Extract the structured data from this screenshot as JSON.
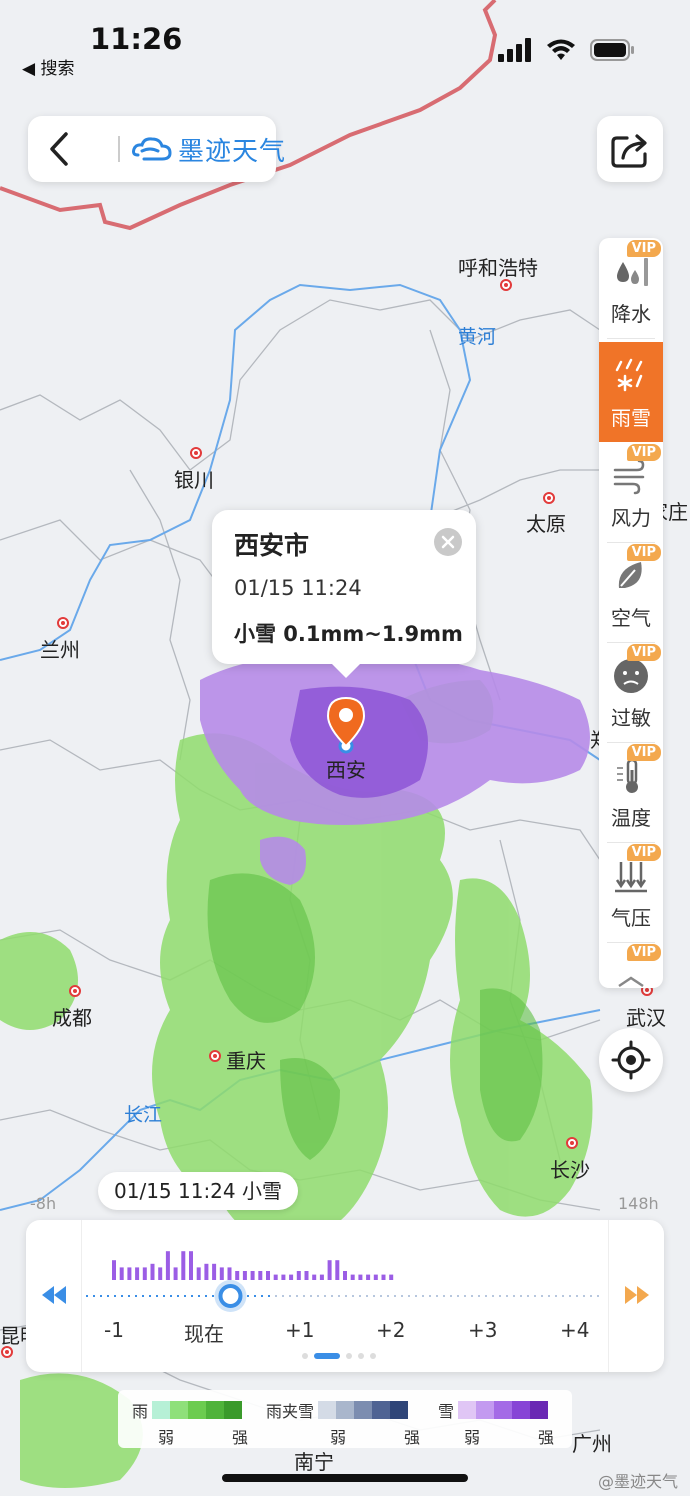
{
  "status": {
    "time": "11:26",
    "back_label": "◀ 搜索"
  },
  "header": {
    "app_name": "墨迹天气"
  },
  "layers": [
    {
      "label": "降水",
      "vip": "VIP",
      "icon": "rain-drops-icon"
    },
    {
      "label": "雨雪",
      "vip": "",
      "icon": "rain-snow-icon"
    },
    {
      "label": "风力",
      "vip": "VIP",
      "icon": "wind-icon"
    },
    {
      "label": "空气",
      "vip": "VIP",
      "icon": "leaf-icon"
    },
    {
      "label": "过敏",
      "vip": "VIP",
      "icon": "allergy-face-icon"
    },
    {
      "label": "温度",
      "vip": "VIP",
      "icon": "thermometer-icon"
    },
    {
      "label": "气压",
      "vip": "VIP",
      "icon": "pressure-icon"
    },
    {
      "label": "",
      "vip": "VIP",
      "icon": "more-layer-icon"
    }
  ],
  "popup": {
    "city": "西安市",
    "time": "01/15 11:24",
    "amount": "小雪 0.1mm~1.9mm"
  },
  "cities": [
    "呼和浩特",
    "银川",
    "太原",
    "兰州",
    "西安",
    "成都",
    "重庆",
    "武汉",
    "长沙",
    "南宁",
    "家庄",
    "郑",
    "昆明",
    "广州"
  ],
  "rivers": [
    "黄河",
    "长江"
  ],
  "timeline": {
    "bubble": "01/15 11:24  小雪",
    "left_label": "-8h",
    "right_label": "148h",
    "hours": [
      "-1",
      "现在",
      "+1",
      "+2",
      "+3",
      "+4"
    ],
    "bars": [
      0.55,
      0.35,
      0.35,
      0.35,
      0.35,
      0.45,
      0.35,
      0.8,
      0.35,
      0.8,
      0.8,
      0.35,
      0.45,
      0.45,
      0.35,
      0.35,
      0.25,
      0.25,
      0.25,
      0.25,
      0.25,
      0.15,
      0.15,
      0.15,
      0.25,
      0.25,
      0.15,
      0.15,
      0.55,
      0.55,
      0.25,
      0.15,
      0.15,
      0.15,
      0.15,
      0.15,
      0.15
    ],
    "current_position": 0.28
  },
  "legend": {
    "rain": "雨",
    "mixed": "雨夹雪",
    "snow": "雪",
    "weak": "弱",
    "strong": "强",
    "rain_colors": [
      "#b6f0d6",
      "#8fe07a",
      "#6ccc4f",
      "#4fb33a",
      "#3a9a2b"
    ],
    "mixed_colors": [
      "#d4dbe6",
      "#a9b6cc",
      "#7c8db0",
      "#4f6393",
      "#2f4578"
    ],
    "snow_colors": [
      "#e0c6f5",
      "#c39af0",
      "#a46be6",
      "#8744d6",
      "#6a28b4"
    ]
  },
  "watermark": "@墨迹天气",
  "colors": {
    "accent": "#f07428",
    "blue": "#2b86e0",
    "pin": "#f06a1f"
  }
}
